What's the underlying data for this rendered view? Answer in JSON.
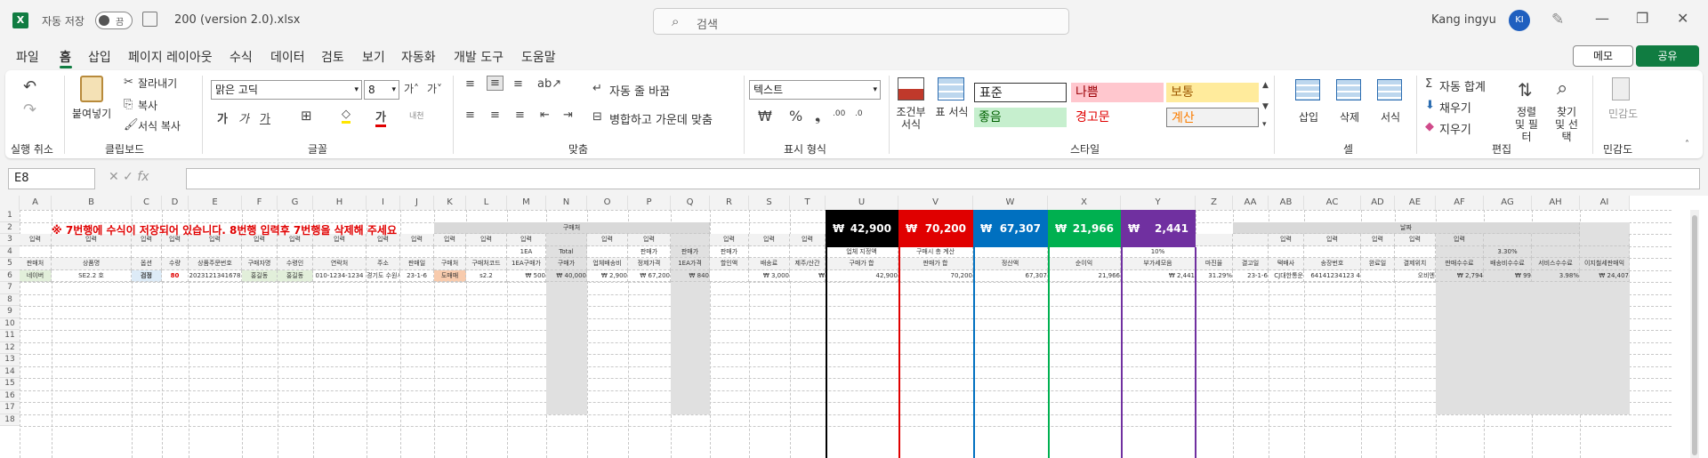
{
  "titlebar": {
    "app_icon": "X",
    "autosave_label": "자동 저장",
    "autosave_state": "끔",
    "filename": "200 (version 2.0).xlsx",
    "search_placeholder": "검색",
    "user_name": "Kang ingyu",
    "user_initials": "KI"
  },
  "menus": [
    "파일",
    "홈",
    "삽입",
    "페이지 레이아웃",
    "수식",
    "데이터",
    "검토",
    "보기",
    "자동화",
    "개발 도구",
    "도움말"
  ],
  "memo_label": "메모",
  "share_label": "공유",
  "ribbon": {
    "undo_group": "실행 취소",
    "clipboard": {
      "paste": "붙여넣기",
      "cut": "잘라내기",
      "copy": "복사",
      "format_painter": "서식 복사",
      "group": "클립보드"
    },
    "font": {
      "name": "맑은 고딕",
      "size": "8",
      "group": "글꼴"
    },
    "align": {
      "wrap": "자동 줄 바꿈",
      "merge": "병합하고 가운데 맞춤",
      "group": "맞춤"
    },
    "number": {
      "format": "텍스트",
      "group": "표시 형식"
    },
    "styles": {
      "cond": "조건부 서식",
      "table": "표 서식",
      "normal": "표준",
      "bad": "나쁨",
      "neutral": "보통",
      "good": "좋음",
      "warn": "경고문",
      "calc": "계산",
      "group": "스타일"
    },
    "cells": {
      "insert": "삽입",
      "delete": "삭제",
      "format": "서식",
      "group": "셀"
    },
    "editing": {
      "autosum": "자동 합계",
      "fill": "채우기",
      "clear": "지우기",
      "sort": "정렬 및 필터",
      "find": "찾기 및 선택",
      "group": "편집"
    },
    "sensitivity": {
      "label": "민감도",
      "group": "민감도"
    }
  },
  "namebox": "E8",
  "columns": [
    "A",
    "B",
    "C",
    "D",
    "E",
    "F",
    "G",
    "H",
    "I",
    "J",
    "K",
    "L",
    "M",
    "N",
    "O",
    "P",
    "Q",
    "R",
    "S",
    "T",
    "U",
    "V",
    "W",
    "X",
    "Y",
    "Z",
    "AA",
    "AB",
    "AC",
    "AD",
    "AE",
    "AF",
    "AG",
    "AH",
    "AI"
  ],
  "rows": [
    "1",
    "2",
    "3",
    "4",
    "5",
    "6",
    "7",
    "8",
    "9",
    "10",
    "11",
    "12",
    "13",
    "14",
    "15",
    "16",
    "17",
    "18"
  ],
  "notice": "※ 7번행에 수식이 저장되어 있습니다. 8번행 입력후 7번행을 삭제해 주세요",
  "summary": [
    {
      "won": "₩",
      "value": "42,900",
      "color": "#000000"
    },
    {
      "won": "₩",
      "value": "70,200",
      "color": "#e00000"
    },
    {
      "won": "₩",
      "value": "67,307",
      "color": "#0070c0"
    },
    {
      "won": "₩",
      "value": "21,966",
      "color": "#00b050"
    },
    {
      "won": "₩",
      "value": "2,441",
      "color": "#7030a0"
    }
  ],
  "row2": {
    "block1": "구매처",
    "block2": "날짜"
  },
  "row3": [
    "입력",
    "입력",
    "입력",
    "입력",
    "입력",
    "입력",
    "입력",
    "입력",
    "입력",
    "입력",
    "입력",
    "입력",
    "입력",
    "",
    "입력",
    "입력",
    "",
    "입력",
    "입력",
    "입력",
    "",
    "",
    "",
    "",
    "",
    "",
    "",
    "입력",
    "입력",
    "입력",
    "입력",
    "입력",
    "",
    "",
    ""
  ],
  "row4": [
    "",
    "",
    "",
    "",
    "",
    "",
    "",
    "",
    "",
    "",
    "",
    "",
    "1EA",
    "Total",
    "",
    "판매가",
    "판매가",
    "판매가",
    "",
    "",
    "업체 지정액",
    "구매시 총 계산",
    "",
    "",
    "10%",
    "",
    "",
    "",
    "",
    "",
    "",
    "",
    "3.30%",
    "",
    ""
  ],
  "row5": [
    "판매처",
    "상품명",
    "옵션",
    "수량",
    "상품주문번호",
    "구매자명",
    "수령인",
    "연락처",
    "주소",
    "판매일",
    "구매처",
    "구매처코드",
    "1EA구매가",
    "구매가",
    "업체배송비",
    "정제가격",
    "1EA가격",
    "할인액",
    "배송료",
    "제주/산간",
    "구매가 합",
    "판매가 합",
    "정산액",
    "순이익",
    "부가세모음",
    "마진율",
    "결고일",
    "택배사",
    "송장번호",
    "완료일",
    "결제위치",
    "판매수수료",
    "배송비수수료",
    "서비스수수료",
    "이지철세판매익"
  ],
  "row6": [
    "네이버",
    "SE2.2 호",
    "검정",
    "80",
    "2023121341678",
    "홍길동",
    "홍길동",
    "010-1234-1234",
    "경기도 수원시 세...",
    "23-1-6",
    "도매매",
    "s2.2",
    "₩ 500",
    "₩ 40,000",
    "₩ 2,900",
    "₩ 67,200",
    "₩ 840",
    "",
    "₩ 3,000",
    "₩",
    "42,900",
    "70,200",
    "67,307",
    "21,966",
    "₩ 2,441",
    "31.29%",
    "23-1-6",
    "CJ대한통운",
    "64141234123 4",
    "",
    "오비엔",
    "₩ 2,794",
    "₩ 99",
    "3.98%",
    "₩ 24,407"
  ]
}
